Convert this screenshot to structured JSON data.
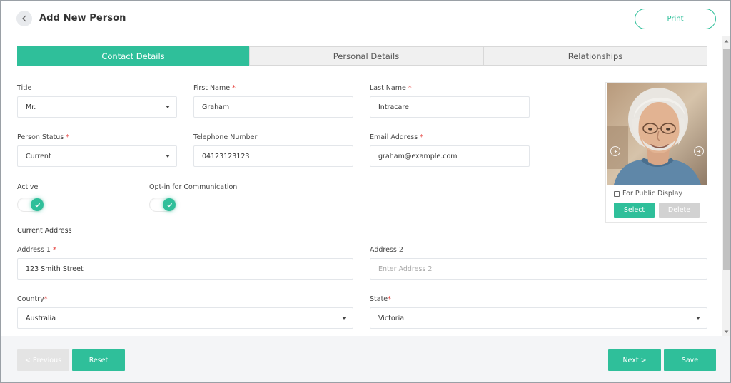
{
  "header": {
    "title": "Add New Person",
    "print_label": "Print"
  },
  "tabs": [
    {
      "label": "Contact Details",
      "active": true
    },
    {
      "label": "Personal Details",
      "active": false
    },
    {
      "label": "Relationships",
      "active": false
    }
  ],
  "form": {
    "title": {
      "label": "Title",
      "value": "Mr."
    },
    "first_name": {
      "label": "First Name",
      "required": "*",
      "value": "Graham"
    },
    "last_name": {
      "label": "Last Name",
      "required": "*",
      "value": "Intracare"
    },
    "person_status": {
      "label": "Person Status",
      "required": "*",
      "value": "Current"
    },
    "telephone": {
      "label": "Telephone Number",
      "value": "04123123123"
    },
    "email": {
      "label": "Email Address",
      "required": "*",
      "value": "graham@example.com"
    },
    "active": {
      "label": "Active",
      "on": true
    },
    "opt_in": {
      "label": "Opt-in for Communication",
      "on": true
    },
    "current_address_title": "Current Address",
    "address1": {
      "label": "Address 1",
      "required": "*",
      "value": "123 Smith Street"
    },
    "address2": {
      "label": "Address 2",
      "placeholder": "Enter Address 2",
      "value": ""
    },
    "country": {
      "label": "Country",
      "required": "*",
      "value": "Australia"
    },
    "state": {
      "label": "State",
      "required": "*",
      "value": "Victoria"
    }
  },
  "photo": {
    "public_display_label": "For Public Display",
    "public_display_checked": false,
    "select_label": "Select",
    "delete_label": "Delete"
  },
  "footer": {
    "previous_label": "< Previous",
    "reset_label": "Reset",
    "next_label": "Next >",
    "save_label": "Save"
  },
  "colors": {
    "accent": "#2fbf9a",
    "required": "#e53935",
    "disabled": "#d2d2d2"
  }
}
